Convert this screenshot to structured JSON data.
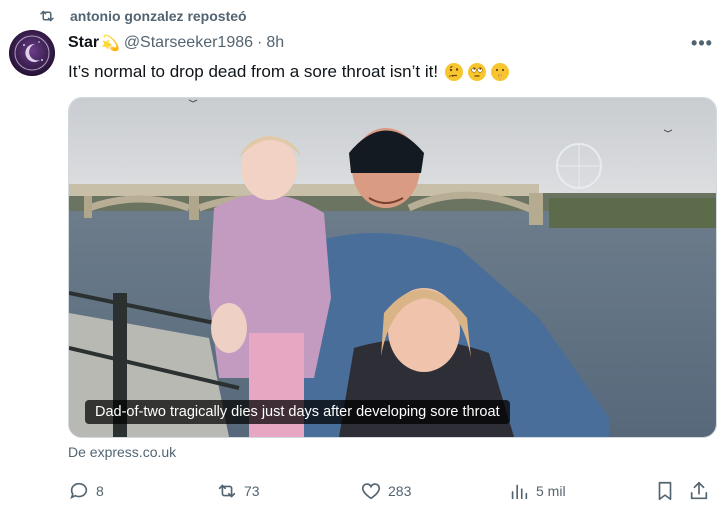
{
  "repost": {
    "text": "antonio gonzalez reposteó"
  },
  "tweet": {
    "name": "Star",
    "name_emoji": "💫",
    "handle": "@Starseeker1986",
    "time": "8h",
    "text": "It’s normal to drop dead from a sore throat isn’t it!",
    "emojis": [
      "thinking-face",
      "rolling-eyes-face",
      "shushing-face"
    ],
    "media_caption": "Dad-of-two tragically dies just days after developing sore throat",
    "source": "De express.co.uk",
    "actions": {
      "replies": "8",
      "reposts": "73",
      "likes": "283",
      "views": "5 mil"
    }
  },
  "colors": {
    "muted": "#536471",
    "text": "#0f1419",
    "border": "#cfd9de"
  }
}
